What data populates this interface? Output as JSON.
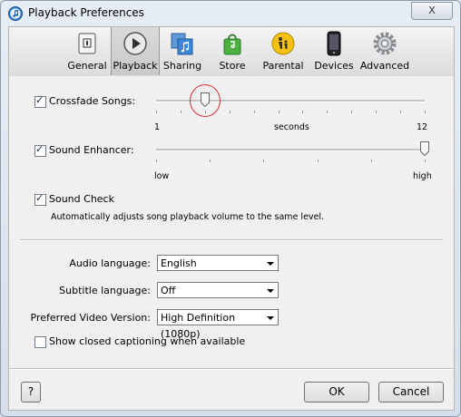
{
  "window": {
    "title": "Playback Preferences",
    "close_glyph": "X"
  },
  "toolbar": {
    "items": [
      {
        "label": "General",
        "icon": "general-icon"
      },
      {
        "label": "Playback",
        "icon": "play-icon",
        "selected": true
      },
      {
        "label": "Sharing",
        "icon": "sharing-icon"
      },
      {
        "label": "Store",
        "icon": "store-bag-icon"
      },
      {
        "label": "Parental",
        "icon": "parental-icon"
      },
      {
        "label": "Devices",
        "icon": "device-icon"
      },
      {
        "label": "Advanced",
        "icon": "gear-icon"
      }
    ]
  },
  "crossfade": {
    "label": "Crossfade Songs:",
    "checked": true,
    "min_label": "1",
    "unit_label": "seconds",
    "max_label": "12",
    "value": 3
  },
  "enhancer": {
    "label": "Sound Enhancer:",
    "checked": true,
    "min_label": "low",
    "max_label": "high",
    "level_fraction": 1.0
  },
  "sound_check": {
    "label": "Sound Check",
    "checked": true,
    "description": "Automatically adjusts song playback volume to the same level."
  },
  "audio_language": {
    "label": "Audio language:",
    "value": "English"
  },
  "subtitle_language": {
    "label": "Subtitle language:",
    "value": "Off"
  },
  "video_version": {
    "label": "Preferred Video Version:",
    "value": "High Definition (1080p)"
  },
  "closed_captioning": {
    "label": "Show closed captioning when available",
    "checked": false
  },
  "buttons": {
    "help": "?",
    "ok": "OK",
    "cancel": "Cancel"
  },
  "colors": {
    "highlight_circle": "#d42b2b"
  }
}
